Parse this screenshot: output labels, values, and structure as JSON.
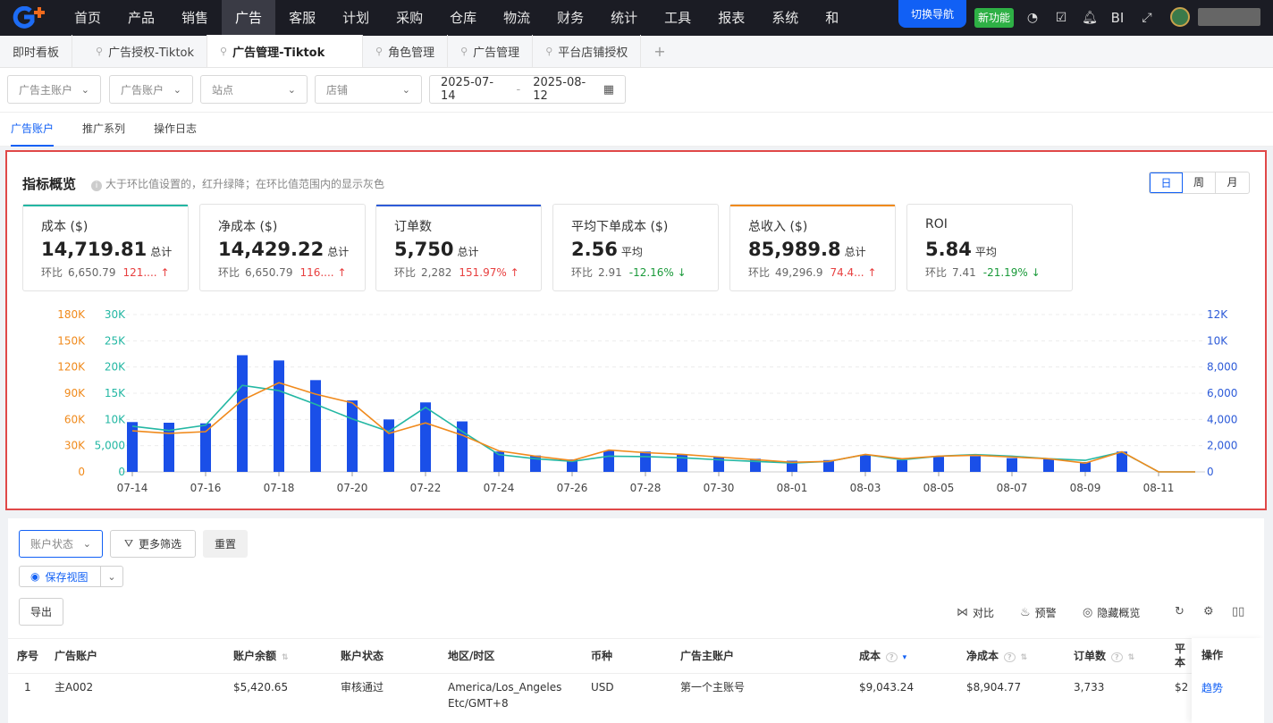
{
  "topnav": {
    "menu": [
      "首页",
      "产品",
      "销售",
      "广告",
      "客服",
      "计划",
      "采购",
      "仓库",
      "物流",
      "财务",
      "统计",
      "工具",
      "报表",
      "系统",
      "和"
    ],
    "active_index": 3,
    "switch_nav": "切换导航",
    "new_feature": "新功能",
    "bi_label": "BI"
  },
  "tabs": [
    {
      "label": "即时看板",
      "pinned": false
    },
    {
      "label": "广告授权-Tiktok",
      "pinned": true
    },
    {
      "label": "广告管理-Tiktok",
      "pinned": true,
      "active": true
    },
    {
      "label": "角色管理",
      "pinned": true
    },
    {
      "label": "广告管理",
      "pinned": true
    },
    {
      "label": "平台店铺授权",
      "pinned": true
    }
  ],
  "tab_add": "+",
  "filters": {
    "ad_main_account": "广告主账户",
    "ad_account": "广告账户",
    "site": "站点",
    "store": "店铺",
    "date_start": "2025-07-14",
    "date_sep": "-",
    "date_end": "2025-08-12"
  },
  "subtabs": [
    "广告账户",
    "推广系列",
    "操作日志"
  ],
  "overview": {
    "title": "指标概览",
    "hint": "大于环比值设置的，红升绿降；在环比值范围内的显示灰色",
    "periods": [
      "日",
      "周",
      "月"
    ],
    "kpis": [
      {
        "label": "成本 ($)",
        "value": "14,719.81",
        "unit": "总计",
        "cmp_label": "环比",
        "cmp_value": "6,650.79",
        "change": "121....",
        "trend": "up",
        "bar_color": "#23b7a3"
      },
      {
        "label": "净成本 ($)",
        "value": "14,429.22",
        "unit": "总计",
        "cmp_label": "环比",
        "cmp_value": "6,650.79",
        "change": "116....",
        "trend": "up",
        "bar_color": ""
      },
      {
        "label": "订单数",
        "value": "5,750",
        "unit": "总计",
        "cmp_label": "环比",
        "cmp_value": "2,282",
        "change": "151.97%",
        "trend": "up",
        "bar_color": "#2d5bd8"
      },
      {
        "label": "平均下单成本 ($)",
        "value": "2.56",
        "unit": "平均",
        "cmp_label": "环比",
        "cmp_value": "2.91",
        "change": "-12.16%",
        "trend": "down",
        "bar_color": ""
      },
      {
        "label": "总收入 ($)",
        "value": "85,989.8",
        "unit": "总计",
        "cmp_label": "环比",
        "cmp_value": "49,296.9",
        "change": "74.4...",
        "trend": "up",
        "bar_color": "#f08a1c"
      },
      {
        "label": "ROI",
        "value": "5.84",
        "unit": "平均",
        "cmp_label": "环比",
        "cmp_value": "7.41",
        "change": "-21.19%",
        "trend": "down",
        "bar_color": ""
      }
    ]
  },
  "chart_data": {
    "type": "bar",
    "x": [
      "07-14",
      "07-15",
      "07-16",
      "07-17",
      "07-18",
      "07-19",
      "07-20",
      "07-21",
      "07-22",
      "07-23",
      "07-24",
      "07-25",
      "07-26",
      "07-27",
      "07-28",
      "07-29",
      "07-30",
      "07-31",
      "08-01",
      "08-02",
      "08-03",
      "08-04",
      "08-05",
      "08-06",
      "08-07",
      "08-08",
      "08-09",
      "08-10",
      "08-11",
      "08-12"
    ],
    "x_tick_labels": [
      "07-14",
      "07-16",
      "07-18",
      "07-20",
      "07-22",
      "07-24",
      "07-26",
      "07-28",
      "07-30",
      "08-01",
      "08-03",
      "08-05",
      "08-07",
      "08-09",
      "08-11"
    ],
    "axes": {
      "left_outer": {
        "ticks": [
          "0",
          "30K",
          "60K",
          "90K",
          "120K",
          "150K",
          "180K"
        ],
        "max": 180000,
        "color": "#f08a1c"
      },
      "left_inner": {
        "ticks": [
          "0",
          "5,000",
          "10K",
          "15K",
          "20K",
          "25K",
          "30K"
        ],
        "max": 30000,
        "color": "#23b7a3"
      },
      "right": {
        "ticks": [
          "0",
          "2,000",
          "4,000",
          "6,000",
          "8,000",
          "10K",
          "12K"
        ],
        "max": 12000,
        "color": "#2d5bd8"
      }
    },
    "series": [
      {
        "kind": "bar",
        "axis": "right",
        "color": "#1a4fe8",
        "values": [
          3800,
          3750,
          3700,
          8900,
          8500,
          7000,
          5450,
          4000,
          5300,
          3850,
          1550,
          1250,
          950,
          1600,
          1550,
          1300,
          1150,
          1000,
          850,
          900,
          1300,
          900,
          1150,
          1200,
          1050,
          1000,
          750,
          1550,
          0,
          0
        ]
      },
      {
        "kind": "line",
        "axis": "left_inner",
        "color": "#23b7a3",
        "values": [
          8700,
          7900,
          8900,
          16500,
          15500,
          12900,
          10100,
          7700,
          12300,
          7700,
          3300,
          2500,
          2000,
          3000,
          2900,
          2700,
          2300,
          2000,
          1700,
          2000,
          3300,
          2300,
          3000,
          3300,
          3000,
          2500,
          2200,
          3800,
          0,
          0
        ]
      },
      {
        "kind": "line",
        "axis": "left_outer",
        "color": "#f08a1c",
        "values": [
          47000,
          44000,
          46000,
          82000,
          102000,
          89000,
          79000,
          44000,
          56000,
          42000,
          24000,
          18000,
          13000,
          25000,
          22000,
          20000,
          17000,
          14000,
          11000,
          12000,
          20000,
          15000,
          18000,
          19000,
          17000,
          15000,
          10000,
          23000,
          0,
          0
        ]
      }
    ],
    "grid": true
  },
  "table": {
    "account_status_placeholder": "账户状态",
    "more_filter": "更多筛选",
    "reset": "重置",
    "save_view": "保存视图",
    "export": "导出",
    "tools": [
      "对比",
      "预警",
      "隐藏概览"
    ],
    "columns": [
      {
        "label": "序号",
        "sort": false
      },
      {
        "label": "广告账户",
        "sort": false
      },
      {
        "label": "账户余额",
        "sort": true
      },
      {
        "label": "账户状态",
        "sort": false
      },
      {
        "label": "地区/时区",
        "sort": false
      },
      {
        "label": "币种",
        "sort": false
      },
      {
        "label": "广告主账户",
        "sort": false
      },
      {
        "label": "成本",
        "sort": true,
        "help": true,
        "active_sort": true
      },
      {
        "label": "净成本",
        "sort": true,
        "help": true
      },
      {
        "label": "订单数",
        "sort": true,
        "help": true
      },
      {
        "label": "平",
        "sort": false
      },
      {
        "label": "操作",
        "sort": false
      }
    ],
    "col10_second_line": "本",
    "rows": [
      {
        "index": "1",
        "account": "主A002",
        "balance": "$5,420.65",
        "status": "审核通过",
        "region": "America/Los_Angeles",
        "timezone": "Etc/GMT+8",
        "currency": "USD",
        "main_account": "第一个主账号",
        "cost": "$9,043.24",
        "net_cost": "$8,904.77",
        "orders": "3,733",
        "avg_partial": "$2",
        "action": "趋势"
      }
    ]
  }
}
